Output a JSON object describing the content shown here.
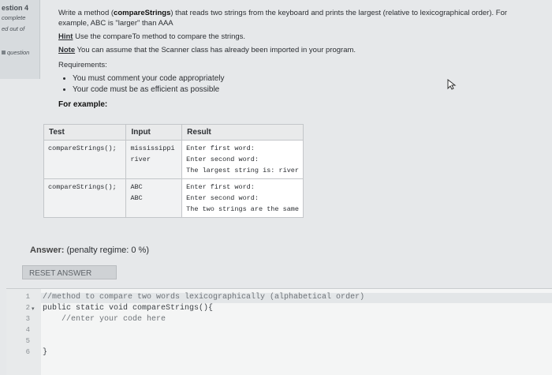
{
  "sidebar": {
    "question_number": "estion 4",
    "status_complete": "complete",
    "status_marked": "ed out of",
    "flag_label": "question"
  },
  "question": {
    "line1_pre": "Write a method (",
    "line1_bold": "compareStrings",
    "line1_post": ") that reads two strings from the keyboard and prints the largest (relative to lexicographical order). For",
    "line2": "example, ABC is \"larger\" than AAA",
    "hint_label": "Hint",
    "hint_text": " Use the compareTo method to compare the strings.",
    "note_label": "Note",
    "note_text": " You can assume that the Scanner class has already been imported in your program.",
    "requirements_label": "Requirements:",
    "requirements": [
      "You must comment your code appropriately",
      "Your code must be as efficient as possible"
    ],
    "for_example": "For example:"
  },
  "examples_table": {
    "headers": [
      "Test",
      "Input",
      "Result"
    ],
    "rows": [
      {
        "test": "compareStrings();",
        "input": "mississippi\nriver",
        "result": "Enter first word:\nEnter second word:\nThe largest string is: river"
      },
      {
        "test": "compareStrings();",
        "input": "ABC\nABC",
        "result": "Enter first word:\nEnter second word:\nThe two strings are the same"
      }
    ]
  },
  "answer": {
    "label": "Answer:",
    "penalty": " (penalty regime: 0 %)",
    "reset_button": "RESET ANSWER"
  },
  "editor": {
    "line_numbers": [
      "1",
      "2",
      "3",
      "4",
      "5",
      "6"
    ],
    "lines": [
      "//method to compare two words lexicographically (alphabetical order)",
      "public static void compareStrings(){",
      "    //enter your code here",
      "",
      "",
      "}"
    ]
  },
  "icons": {
    "cursor": "mouse-pointer-icon",
    "fold": "fold-arrow-icon"
  }
}
